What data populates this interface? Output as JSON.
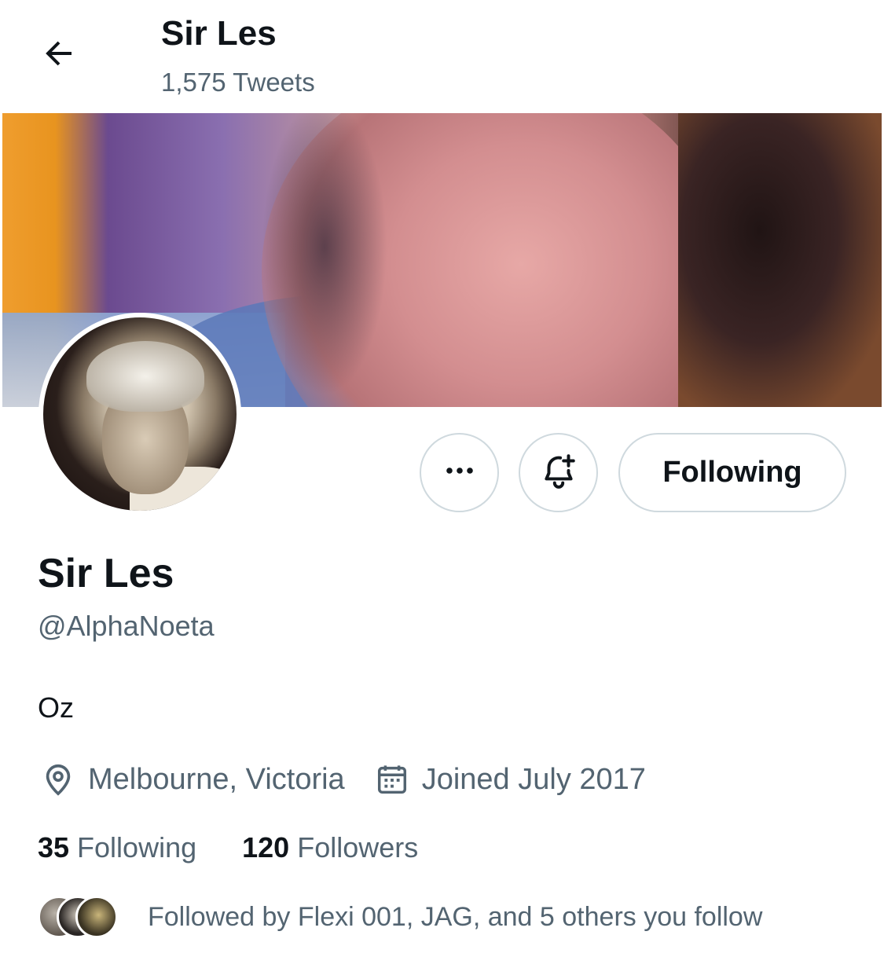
{
  "header": {
    "title": "Sir Les",
    "tweet_count": "1,575 Tweets",
    "back_icon": "arrow-left-icon"
  },
  "profile": {
    "display_name": "Sir Les",
    "handle": "@AlphaNoeta",
    "bio": "Oz",
    "location": "Melbourne, Victoria",
    "joined": "Joined July 2017",
    "location_icon": "location-pin-icon",
    "joined_icon": "calendar-icon"
  },
  "actions": {
    "more_icon": "more-icon",
    "notify_icon": "bell-plus-icon",
    "following_label": "Following"
  },
  "stats": {
    "following_count": "35",
    "following_label": "Following",
    "followers_count": "120",
    "followers_label": "Followers"
  },
  "followed_by": {
    "text": "Followed by Flexi 001, JAG, and 5 others you follow"
  },
  "colors": {
    "text_primary": "#0f1419",
    "text_secondary": "#536471",
    "border": "#cfd9de"
  }
}
